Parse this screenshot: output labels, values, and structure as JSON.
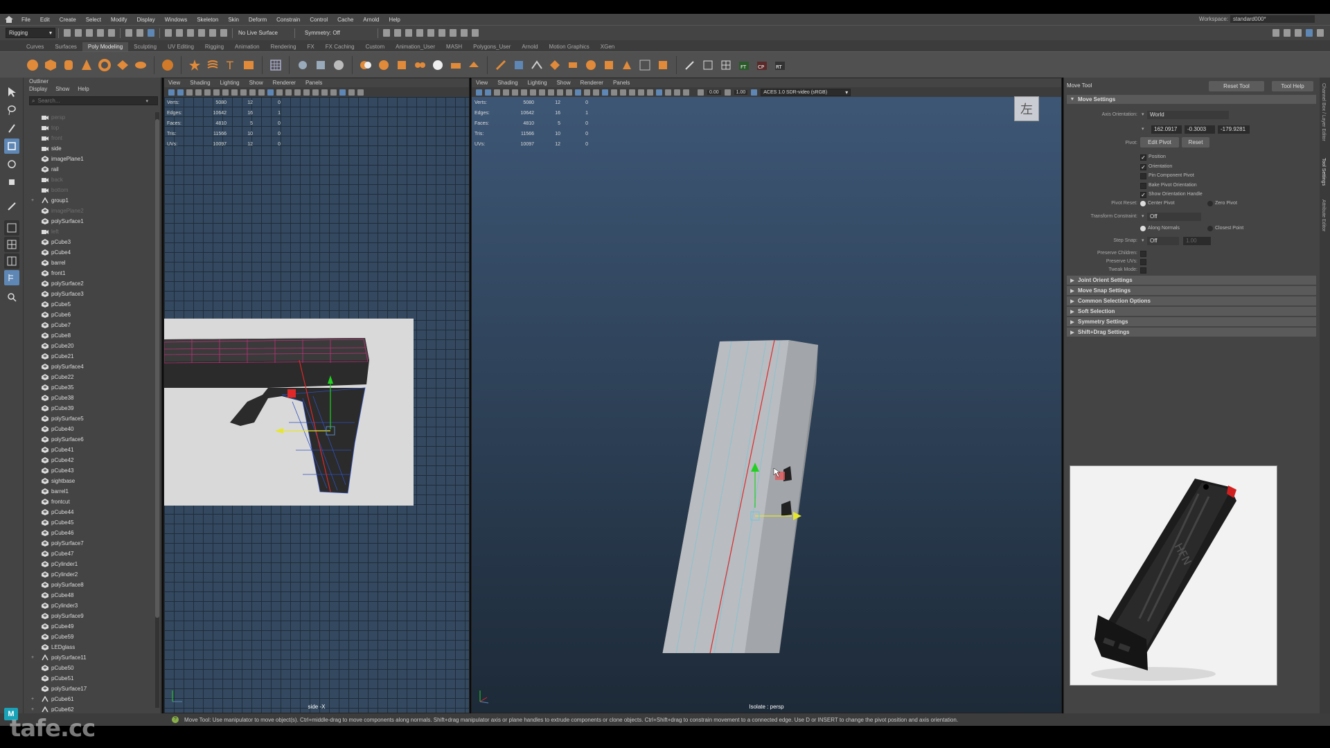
{
  "menubar": {
    "items": [
      "File",
      "Edit",
      "Create",
      "Select",
      "Modify",
      "Display",
      "Windows",
      "Skeleton",
      "Skin",
      "Deform",
      "Constrain",
      "Control",
      "Cache",
      "Arnold",
      "Help"
    ],
    "workspace_label": "Workspace:",
    "workspace_value": "standard000*"
  },
  "statusline": {
    "mode": "Rigging",
    "live_surface": "No Live Surface",
    "symmetry": "Symmetry: Off"
  },
  "shelf": {
    "tabs": [
      "Curves",
      "Surfaces",
      "Poly Modeling",
      "Sculpting",
      "UV Editing",
      "Rigging",
      "Animation",
      "Rendering",
      "FX",
      "FX Caching",
      "Custom",
      "Animation_User",
      "MASH",
      "Polygons_User",
      "Arnold",
      "Motion Graphics",
      "XGen"
    ],
    "active_tab": "Poly Modeling",
    "icon_labels": [
      "FT",
      "CP",
      "RT"
    ]
  },
  "outliner": {
    "title": "Outliner",
    "menu": [
      "Display",
      "Show",
      "Help"
    ],
    "search_placeholder": "Search...",
    "items": [
      {
        "name": "persp",
        "icon": "camera",
        "dim": true,
        "exp": ""
      },
      {
        "name": "top",
        "icon": "camera",
        "dim": true,
        "exp": ""
      },
      {
        "name": "front",
        "icon": "camera",
        "dim": true,
        "exp": ""
      },
      {
        "name": "side",
        "icon": "camera",
        "dim": false,
        "exp": ""
      },
      {
        "name": "imagePlane1",
        "icon": "mesh",
        "dim": false,
        "exp": ""
      },
      {
        "name": "rail",
        "icon": "mesh",
        "dim": false,
        "exp": ""
      },
      {
        "name": "back",
        "icon": "camera",
        "dim": true,
        "exp": ""
      },
      {
        "name": "bottom",
        "icon": "camera",
        "dim": true,
        "exp": ""
      },
      {
        "name": "group1",
        "icon": "group",
        "dim": false,
        "exp": "+"
      },
      {
        "name": "imagePlane2",
        "icon": "mesh",
        "dim": true,
        "exp": ""
      },
      {
        "name": "polySurface1",
        "icon": "mesh",
        "dim": false,
        "exp": ""
      },
      {
        "name": "left",
        "icon": "camera",
        "dim": true,
        "exp": ""
      },
      {
        "name": "pCube3",
        "icon": "mesh",
        "dim": false,
        "exp": ""
      },
      {
        "name": "pCube4",
        "icon": "mesh",
        "dim": false,
        "exp": ""
      },
      {
        "name": "barrel",
        "icon": "mesh",
        "dim": false,
        "exp": ""
      },
      {
        "name": "front1",
        "icon": "mesh",
        "dim": false,
        "exp": ""
      },
      {
        "name": "polySurface2",
        "icon": "mesh",
        "dim": false,
        "exp": ""
      },
      {
        "name": "polySurface3",
        "icon": "mesh",
        "dim": false,
        "exp": ""
      },
      {
        "name": "pCube5",
        "icon": "mesh",
        "dim": false,
        "exp": ""
      },
      {
        "name": "pCube6",
        "icon": "mesh",
        "dim": false,
        "exp": ""
      },
      {
        "name": "pCube7",
        "icon": "mesh",
        "dim": false,
        "exp": ""
      },
      {
        "name": "pCube8",
        "icon": "mesh",
        "dim": false,
        "exp": ""
      },
      {
        "name": "pCube20",
        "icon": "mesh",
        "dim": false,
        "exp": ""
      },
      {
        "name": "pCube21",
        "icon": "mesh",
        "dim": false,
        "exp": ""
      },
      {
        "name": "polySurface4",
        "icon": "mesh",
        "dim": false,
        "exp": ""
      },
      {
        "name": "pCube22",
        "icon": "mesh",
        "dim": false,
        "exp": ""
      },
      {
        "name": "pCube35",
        "icon": "mesh",
        "dim": false,
        "exp": ""
      },
      {
        "name": "pCube38",
        "icon": "mesh",
        "dim": false,
        "exp": ""
      },
      {
        "name": "pCube39",
        "icon": "mesh",
        "dim": false,
        "exp": ""
      },
      {
        "name": "polySurface5",
        "icon": "mesh",
        "dim": false,
        "exp": ""
      },
      {
        "name": "pCube40",
        "icon": "mesh",
        "dim": false,
        "exp": ""
      },
      {
        "name": "polySurface6",
        "icon": "mesh",
        "dim": false,
        "exp": ""
      },
      {
        "name": "pCube41",
        "icon": "mesh",
        "dim": false,
        "exp": ""
      },
      {
        "name": "pCube42",
        "icon": "mesh",
        "dim": false,
        "exp": ""
      },
      {
        "name": "pCube43",
        "icon": "mesh",
        "dim": false,
        "exp": ""
      },
      {
        "name": "sightbase",
        "icon": "mesh",
        "dim": false,
        "exp": ""
      },
      {
        "name": "barrel1",
        "icon": "mesh",
        "dim": false,
        "exp": ""
      },
      {
        "name": "frontcut",
        "icon": "mesh",
        "dim": false,
        "exp": ""
      },
      {
        "name": "pCube44",
        "icon": "mesh",
        "dim": false,
        "exp": ""
      },
      {
        "name": "pCube45",
        "icon": "mesh",
        "dim": false,
        "exp": ""
      },
      {
        "name": "pCube46",
        "icon": "mesh",
        "dim": false,
        "exp": ""
      },
      {
        "name": "polySurface7",
        "icon": "mesh",
        "dim": false,
        "exp": ""
      },
      {
        "name": "pCube47",
        "icon": "mesh",
        "dim": false,
        "exp": ""
      },
      {
        "name": "pCylinder1",
        "icon": "mesh",
        "dim": false,
        "exp": ""
      },
      {
        "name": "pCylinder2",
        "icon": "mesh",
        "dim": false,
        "exp": ""
      },
      {
        "name": "polySurface8",
        "icon": "mesh",
        "dim": false,
        "exp": ""
      },
      {
        "name": "pCube48",
        "icon": "mesh",
        "dim": false,
        "exp": ""
      },
      {
        "name": "pCylinder3",
        "icon": "mesh",
        "dim": false,
        "exp": ""
      },
      {
        "name": "polySurface9",
        "icon": "mesh",
        "dim": false,
        "exp": ""
      },
      {
        "name": "pCube49",
        "icon": "mesh",
        "dim": false,
        "exp": ""
      },
      {
        "name": "pCube59",
        "icon": "mesh",
        "dim": false,
        "exp": ""
      },
      {
        "name": "LEDglass",
        "icon": "mesh",
        "dim": false,
        "exp": ""
      },
      {
        "name": "polySurface11",
        "icon": "group",
        "dim": false,
        "exp": "+"
      },
      {
        "name": "pCube50",
        "icon": "mesh",
        "dim": false,
        "exp": ""
      },
      {
        "name": "pCube51",
        "icon": "mesh",
        "dim": false,
        "exp": ""
      },
      {
        "name": "polySurface17",
        "icon": "mesh",
        "dim": false,
        "exp": ""
      },
      {
        "name": "pCube61",
        "icon": "group",
        "dim": false,
        "exp": "+"
      },
      {
        "name": "pCube62",
        "icon": "group",
        "dim": false,
        "exp": "+"
      }
    ]
  },
  "viewport_left": {
    "menu": [
      "View",
      "Shading",
      "Lighting",
      "Show",
      "Renderer",
      "Panels"
    ],
    "hud": [
      {
        "label": "Verts:",
        "a": "5080",
        "b": "12",
        "c": "0"
      },
      {
        "label": "Edges:",
        "a": "10642",
        "b": "16",
        "c": "1"
      },
      {
        "label": "Faces:",
        "a": "4810",
        "b": "5",
        "c": "0"
      },
      {
        "label": "Tris:",
        "a": "11566",
        "b": "10",
        "c": "0"
      },
      {
        "label": "UVs:",
        "a": "10097",
        "b": "12",
        "c": "0"
      }
    ],
    "caption": "side -X"
  },
  "viewport_right": {
    "menu": [
      "View",
      "Shading",
      "Lighting",
      "Show",
      "Renderer",
      "Panels"
    ],
    "hud": [
      {
        "label": "Verts:",
        "a": "5080",
        "b": "12",
        "c": "0"
      },
      {
        "label": "Edges:",
        "a": "10642",
        "b": "16",
        "c": "1"
      },
      {
        "label": "Faces:",
        "a": "4810",
        "b": "5",
        "c": "0"
      },
      {
        "label": "Tris:",
        "a": "11566",
        "b": "10",
        "c": "0"
      },
      {
        "label": "UVs:",
        "a": "10097",
        "b": "12",
        "c": "0"
      }
    ],
    "field_a": "0.00",
    "field_b": "1.00",
    "colorspace": "ACES 1.0 SDR-video (sRGB)",
    "viewcube": "左",
    "caption": "Isolate : persp"
  },
  "tool_settings": {
    "title": "Move Tool",
    "reset_btn": "Reset Tool",
    "help_btn": "Tool Help",
    "section_move": "Move Settings",
    "axis_orientation_label": "Axis Orientation:",
    "axis_orientation_value": "World",
    "axis_values": [
      "162.0917",
      "-0.3003",
      "-179.9281"
    ],
    "pivot_label": "Pivot:",
    "edit_pivot_btn": "Edit Pivot",
    "reset_pivot_btn": "Reset",
    "checks": [
      {
        "label": "Position",
        "checked": true
      },
      {
        "label": "Orientation",
        "checked": true
      },
      {
        "label": "Pin Component Pivot",
        "checked": false
      },
      {
        "label": "Bake Pivot Orientation",
        "checked": false
      },
      {
        "label": "Show Orientation Handle",
        "checked": true
      }
    ],
    "pivot_reset_label": "Pivot Reset:",
    "center_pivot": "Center Pivot",
    "zero_pivot": "Zero Pivot",
    "transform_constraint_label": "Transform Constraint:",
    "transform_constraint_value": "Off",
    "along_normals": "Along Normals",
    "closest_point": "Closest Point",
    "step_snap_label": "Step Snap:",
    "step_snap_value": "Off",
    "step_snap_amount": "1.00",
    "preserve_children": "Preserve Children:",
    "preserve_uvs": "Preserve UVs:",
    "tweak_mode": "Tweak Mode:",
    "sections": [
      "Joint Orient Settings",
      "Move Snap Settings",
      "Common Selection Options",
      "Soft Selection",
      "Symmetry Settings",
      "Shift+Drag Settings"
    ],
    "side_tabs": [
      "Channel Box / Layer Editor",
      "Tool Settings",
      "Attribute Editor"
    ]
  },
  "reference": {
    "stamp": "HFN"
  },
  "helpline": {
    "text": "Move Tool: Use manipulator to move object(s). Ctrl+middle-drag to move components along normals. Shift+drag manipulator axis or plane handles to extrude components or clone objects. Ctrl+Shift+drag to constrain movement to a connected edge. Use D or INSERT to change the pivot position and axis orientation."
  },
  "watermark": "tafe.cc",
  "colors": {
    "accent_blue": "#5e87b5",
    "manipulator_green": "#22d022",
    "manipulator_yellow": "#e6e62a",
    "manipulator_red": "#e02828",
    "shelf_orange": "#e08a3a"
  }
}
